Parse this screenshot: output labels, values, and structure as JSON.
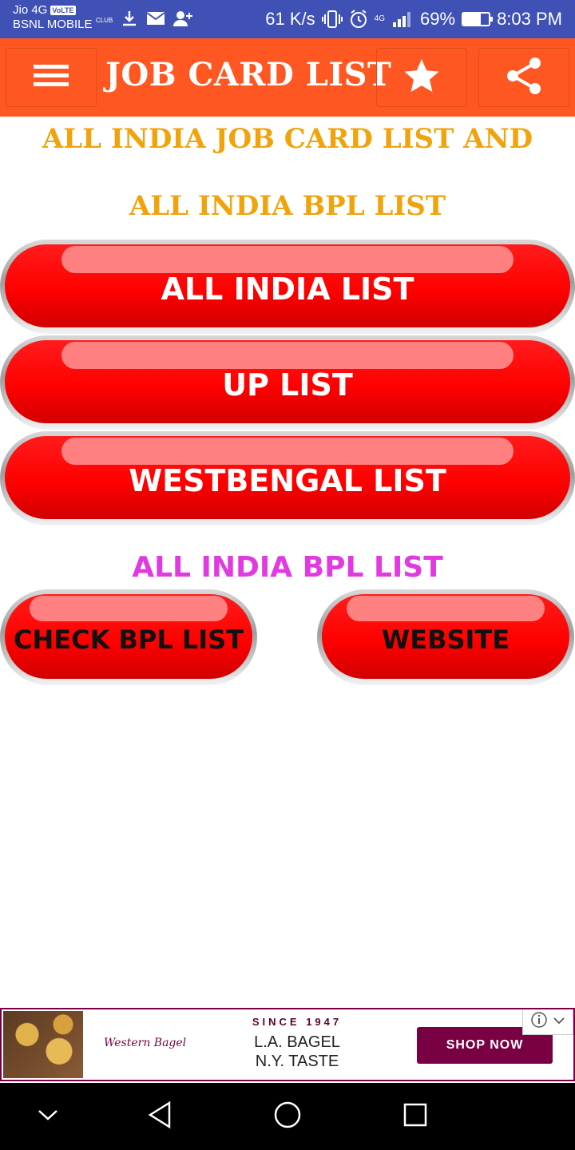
{
  "status_bar": {
    "carrier1": "Jio 4G",
    "volte": "VoLTE",
    "carrier2": "BSNL MOBILE",
    "club": "CLUB",
    "net_speed": "61 K/s",
    "network_type": "4G",
    "battery": "69%",
    "battery_level": 0.69,
    "time": "8:03 PM"
  },
  "app_bar": {
    "title": "JOB CARD LIST",
    "menu_icon": "menu-icon",
    "star_icon": "star-icon",
    "share_icon": "share-icon"
  },
  "headings": {
    "line1": "ALL INDIA JOB CARD LIST AND",
    "line2": "ALL INDIA BPL LIST"
  },
  "buttons": {
    "all_india": "ALL INDIA LIST",
    "up": "UP LIST",
    "westbengal": "WESTBENGAL LIST"
  },
  "bpl_section": {
    "title": "ALL INDIA BPL LIST",
    "check": "CHECK BPL LIST",
    "website": "WEBSITE"
  },
  "ad": {
    "brand": "Western Bagel",
    "since": "SINCE 1947",
    "line1": "L.A. BAGEL",
    "line2": "N.Y. TASTE",
    "cta": "SHOP NOW"
  },
  "colors": {
    "status_bar": "#3f51b5",
    "app_bar": "#ff5722",
    "heading": "#f0a30a",
    "button_red": "#ff0000",
    "bpl_heading": "#e03ae0",
    "ad_accent": "#7a0044"
  }
}
